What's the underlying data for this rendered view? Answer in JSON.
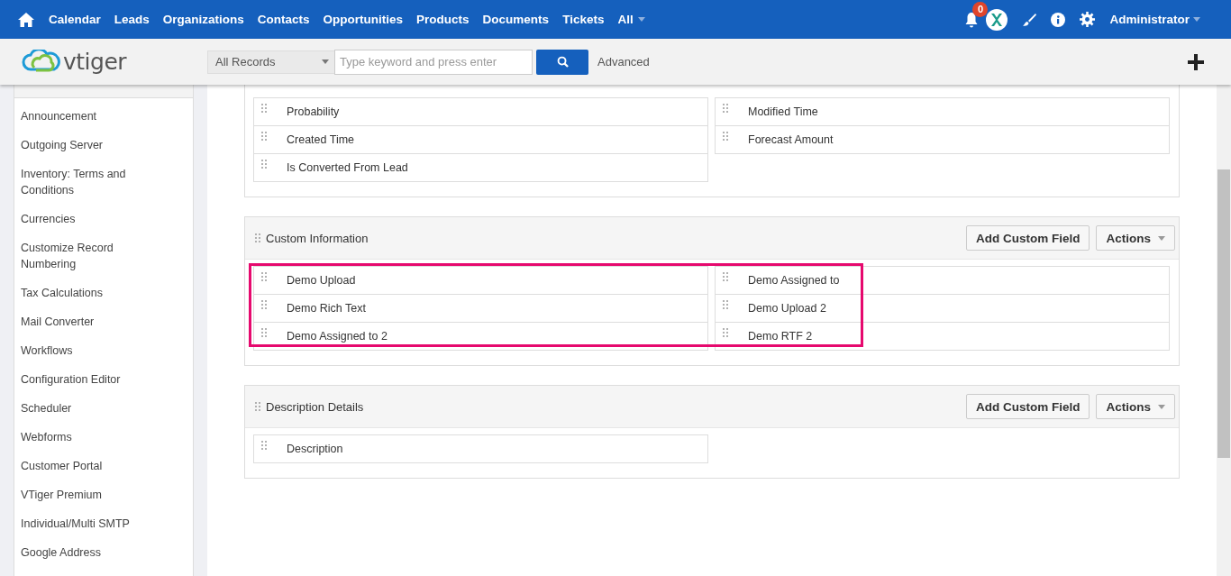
{
  "nav": {
    "items": [
      "Calendar",
      "Leads",
      "Organizations",
      "Contacts",
      "Opportunities",
      "Products",
      "Documents",
      "Tickets",
      "All"
    ],
    "notification_count": "0",
    "user": "Administrator"
  },
  "toolbar": {
    "logo": "vtiger",
    "filter": "All Records",
    "search": {
      "placeholder": "Type keyword and press enter"
    },
    "advanced": "Advanced"
  },
  "sidebar": {
    "items": [
      "Announcement",
      "Outgoing Server",
      "Inventory: Terms and Conditions",
      "Currencies",
      "Customize Record Numbering",
      "Tax Calculations",
      "Mail Converter",
      "Workflows",
      "Configuration Editor",
      "Scheduler",
      "Webforms",
      "Customer Portal",
      "VTiger Premium",
      "Individual/Multi SMTP",
      "Google Address"
    ]
  },
  "sections": [
    {
      "highlighted": false,
      "left": [
        "Probability",
        "Created Time",
        "Is Converted From Lead"
      ],
      "right": [
        "Modified Time",
        "Forecast Amount"
      ]
    },
    {
      "title": "Custom Information",
      "highlighted": true,
      "buttons": [
        "Add Custom Field",
        "Actions"
      ],
      "left": [
        "Demo Upload",
        "Demo Rich Text",
        "Demo Assigned to 2"
      ],
      "right": [
        "Demo Assigned to",
        "Demo Upload 2",
        "Demo RTF 2"
      ]
    },
    {
      "title": "Description Details",
      "highlighted": false,
      "buttons": [
        "Add Custom Field",
        "Actions"
      ],
      "left": [
        "Description"
      ]
    }
  ]
}
